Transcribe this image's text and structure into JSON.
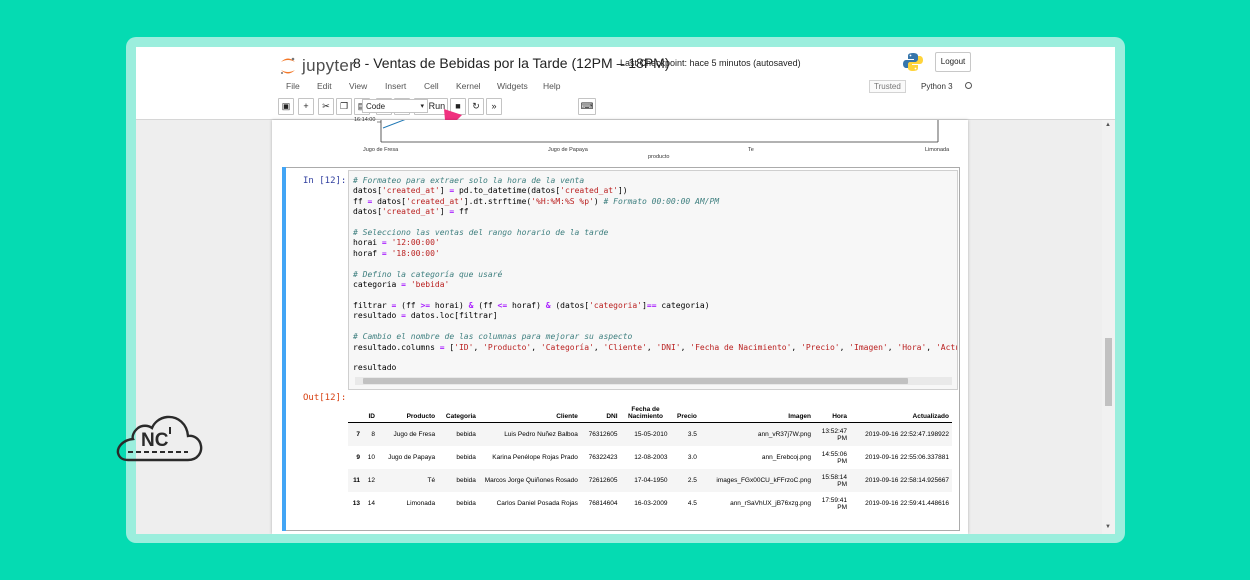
{
  "app": {
    "logo_text": "jupyter",
    "notebook_title": "8 - Ventas de Bebidas por la Tarde (12PM – 18PM)",
    "checkpoint": "Last Checkpoint: hace 5 minutos  (autosaved)",
    "logout_label": "Logout",
    "trusted_label": "Trusted",
    "kernel_label": "Python 3"
  },
  "menu": [
    "File",
    "Edit",
    "View",
    "Insert",
    "Cell",
    "Kernel",
    "Widgets",
    "Help"
  ],
  "toolbar": {
    "run_label": "Run",
    "cell_type": "Code",
    "icons": [
      "save-icon",
      "plus-icon",
      "cut-icon",
      "copy-icon",
      "paste-icon",
      "arrow-up-icon",
      "arrow-down-icon",
      "run-icon",
      "stop-icon",
      "restart-icon",
      "fast-forward-icon",
      "keyboard-icon"
    ]
  },
  "plot_tail": {
    "ytick": "16:14:00",
    "xticks": [
      "Jugo de Fresa",
      "Jugo de Papaya",
      "Te",
      "Limonada"
    ],
    "xlabel": "producto"
  },
  "cell": {
    "in_prompt": "In [12]:",
    "out_prompt": "Out[12]:"
  },
  "table": {
    "columns": [
      "",
      "ID",
      "Producto",
      "Categoria",
      "Cliente",
      "DNI",
      "Fecha de Nacimiento",
      "Precio",
      "Imagen",
      "Hora",
      "Actualizado"
    ],
    "rows": [
      [
        "7",
        "8",
        "Jugo de Fresa",
        "bebida",
        "Luis Pedro Nuñez Balboa",
        "76312605",
        "15-05-2010",
        "3.5",
        "ann_vR37j7W.png",
        "13:52:47 PM",
        "2019-09-16 22:52:47.198922"
      ],
      [
        "9",
        "10",
        "Jugo de Papaya",
        "bebida",
        "Karina Penélope Rojas Prado",
        "76322423",
        "12-08-2003",
        "3.0",
        "ann_Erebcoj.png",
        "14:55:06 PM",
        "2019-09-16 22:55:06.337881"
      ],
      [
        "11",
        "12",
        "Té",
        "bebida",
        "Marcos Jorge Quiñones Rosado",
        "72612605",
        "17-04-1950",
        "2.5",
        "images_FGx00CU_kFFrzoC.png",
        "15:58:14 PM",
        "2019-09-16 22:58:14.925667"
      ],
      [
        "13",
        "14",
        "Limonada",
        "bebida",
        "Carlos Daniel Posada Rojas",
        "76814604",
        "16-03-2009",
        "4.5",
        "ann_rSaVhUX_jB76xzg.png",
        "17:59:41 PM",
        "2019-09-16 22:59:41.448616"
      ]
    ]
  },
  "brand": {
    "nc_text": "NC"
  },
  "colors": {
    "background": "#05dbb2",
    "accent_arrow": "#f0317f",
    "cell_selected": "#42a5f5"
  }
}
